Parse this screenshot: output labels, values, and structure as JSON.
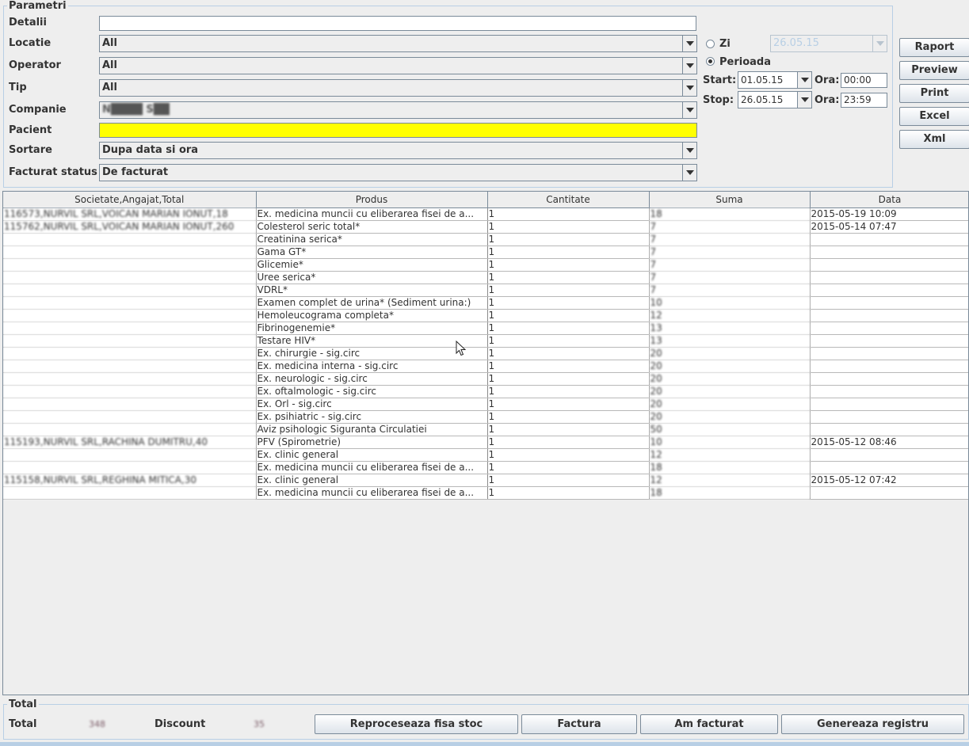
{
  "params": {
    "legend": "Parametri",
    "detalii": {
      "label": "Detalii",
      "value": ""
    },
    "locatie": {
      "label": "Locatie",
      "value": "All"
    },
    "operator": {
      "label": "Operator",
      "value": "All"
    },
    "tip": {
      "label": "Tip",
      "value": "All"
    },
    "companie": {
      "label": "Companie",
      "value": "N████ S██"
    },
    "pacient": {
      "label": "Pacient",
      "value": ""
    },
    "sortare": {
      "label": "Sortare",
      "value": "Dupa data si ora"
    },
    "facturat_status": {
      "label": "Facturat status",
      "value": "De facturat"
    }
  },
  "period": {
    "zi_label": "Zi",
    "zi_value": "26.05.15",
    "perioada_label": "Perioada",
    "selected": "perioada",
    "start_label": "Start:",
    "start_value": "01.05.15",
    "stop_label": "Stop:",
    "stop_value": "26.05.15",
    "ora_label": "Ora:",
    "start_ora": "00:00",
    "stop_ora": "23:59"
  },
  "actions": {
    "raport": "Raport",
    "preview": "Preview",
    "print": "Print",
    "excel": "Excel",
    "xml": "Xml"
  },
  "table": {
    "headers": [
      "Societate,Angajat,Total",
      "Produs",
      "Cantitate",
      "Suma",
      "Data"
    ],
    "rows": [
      [
        "116573,NURVIL SRL,VOICAN MARIAN IONUT,18",
        "Ex. medicina muncii cu eliberarea fisei de a...",
        "1",
        "18",
        "2015-05-19 10:09"
      ],
      [
        "115762,NURVIL SRL,VOICAN MARIAN IONUT,260",
        "Colesterol seric total*",
        "1",
        "7",
        "2015-05-14 07:47"
      ],
      [
        "",
        "Creatinina serica*",
        "1",
        "7",
        ""
      ],
      [
        "",
        "Gama GT*",
        "1",
        "7",
        ""
      ],
      [
        "",
        "Glicemie*",
        "1",
        "7",
        ""
      ],
      [
        "",
        "Uree serica*",
        "1",
        "7",
        ""
      ],
      [
        "",
        "VDRL*",
        "1",
        "7",
        ""
      ],
      [
        "",
        "Examen complet de urina* (Sediment urina:)",
        "1",
        "10",
        ""
      ],
      [
        "",
        "Hemoleucograma completa*",
        "1",
        "12",
        ""
      ],
      [
        "",
        "Fibrinogenemie*",
        "1",
        "13",
        ""
      ],
      [
        "",
        "Testare HIV*",
        "1",
        "13",
        ""
      ],
      [
        "",
        "Ex. chirurgie - sig.circ",
        "1",
        "20",
        ""
      ],
      [
        "",
        "Ex. medicina interna - sig.circ",
        "1",
        "20",
        ""
      ],
      [
        "",
        "Ex. neurologic - sig.circ",
        "1",
        "20",
        ""
      ],
      [
        "",
        "Ex. oftalmologic - sig.circ",
        "1",
        "20",
        ""
      ],
      [
        "",
        "Ex. Orl - sig.circ",
        "1",
        "20",
        ""
      ],
      [
        "",
        "Ex. psihiatric - sig.circ",
        "1",
        "20",
        ""
      ],
      [
        "",
        "Aviz psihologic Siguranta Circulatiei",
        "1",
        "50",
        ""
      ],
      [
        "115193,NURVIL SRL,RACHINA DUMITRU,40",
        "PFV (Spirometrie)",
        "1",
        "10",
        "2015-05-12 08:46"
      ],
      [
        "",
        "Ex. clinic general",
        "1",
        "12",
        ""
      ],
      [
        "",
        "Ex. medicina muncii cu eliberarea fisei de a...",
        "1",
        "18",
        ""
      ],
      [
        "115158,NURVIL SRL,REGHINA MITICA,30",
        "Ex. clinic general",
        "1",
        "12",
        "2015-05-12 07:42"
      ],
      [
        "",
        "Ex. medicina muncii cu eliberarea fisei de a...",
        "1",
        "18",
        ""
      ]
    ]
  },
  "totals": {
    "legend": "Total",
    "total_label": "Total",
    "total_value": "348",
    "discount_label": "Discount",
    "discount_value": "35"
  },
  "bottom_buttons": {
    "reproceseaza": "Reproceseaza fisa stoc",
    "factura": "Factura",
    "am_facturat": "Am facturat",
    "genereaza": "Genereaza registru"
  },
  "colors": {
    "pacient_bg": "#ffff00",
    "group_border": "#b8cfe5",
    "field_border": "#7a8a99"
  }
}
